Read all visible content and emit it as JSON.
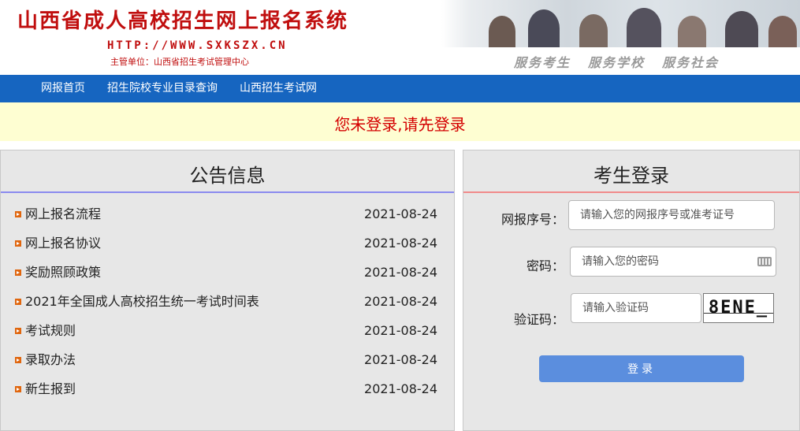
{
  "header": {
    "title": "山西省成人高校招生网上报名系统",
    "url": "HTTP://WWW.SXKSZX.CN",
    "org": "主管单位：山西省招生考试管理中心",
    "slogans": [
      "服务考生",
      "服务学校",
      "服务社会"
    ]
  },
  "nav": {
    "items": [
      "网报首页",
      "招生院校专业目录查询",
      "山西招生考试网"
    ]
  },
  "notice": {
    "text": "您未登录,请先登录"
  },
  "announcements": {
    "title": "公告信息",
    "items": [
      {
        "title": "网上报名流程",
        "date": "2021-08-24"
      },
      {
        "title": "网上报名协议",
        "date": "2021-08-24"
      },
      {
        "title": "奖励照顾政策",
        "date": "2021-08-24"
      },
      {
        "title": "2021年全国成人高校招生统一考试时间表",
        "date": "2021-08-24"
      },
      {
        "title": "考试规则",
        "date": "2021-08-24"
      },
      {
        "title": "录取办法",
        "date": "2021-08-24"
      },
      {
        "title": "新生报到",
        "date": "2021-08-24"
      }
    ]
  },
  "login": {
    "title": "考生登录",
    "id_label": "网报序号：",
    "id_placeholder": "请输入您的网报序号或准考证号",
    "id_value": "",
    "password_label": "密码：",
    "password_placeholder": "请输入您的密码",
    "password_value": "",
    "captcha_label": "验证码：",
    "captcha_placeholder": "请输入验证码",
    "captcha_value": "",
    "captcha_text": "8ENE_",
    "submit_label": "登录",
    "icons": {
      "keyboard": "keyboard-icon",
      "bullet": "arrow-bullet-icon"
    },
    "colors": {
      "nav": "#1665c0",
      "button": "#5b8ede",
      "notice": "#d40000"
    }
  }
}
